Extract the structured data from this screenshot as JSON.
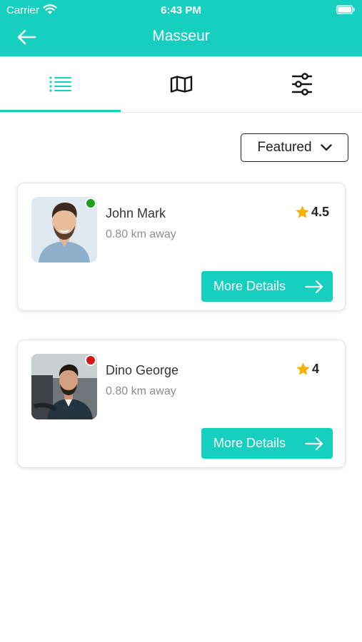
{
  "status_bar": {
    "carrier": "Carrier",
    "time": "6:43 PM",
    "icons": [
      "wifi-icon",
      "battery-icon"
    ]
  },
  "header": {
    "title": "Masseur",
    "back_icon": "arrow-left-icon",
    "background_color": "#17cfbf"
  },
  "tabs": {
    "items": [
      {
        "icon": "list-icon",
        "active": true
      },
      {
        "icon": "map-icon",
        "active": false
      },
      {
        "icon": "sliders-icon",
        "active": false
      }
    ],
    "active_color": "#17cfbf"
  },
  "sort": {
    "selected": "Featured",
    "icon": "chevron-down-icon"
  },
  "masseurs": [
    {
      "name": "John Mark",
      "distance": "0.80 km away",
      "rating": "4.5",
      "status": "online",
      "status_color": "#1ea01e",
      "button_label": "More Details"
    },
    {
      "name": "Dino George",
      "distance": "0.80 km away",
      "rating": "4",
      "status": "busy",
      "status_color": "#d81515",
      "button_label": "More Details"
    }
  ],
  "colors": {
    "accent": "#17cfbf",
    "star": "#f5b301"
  }
}
